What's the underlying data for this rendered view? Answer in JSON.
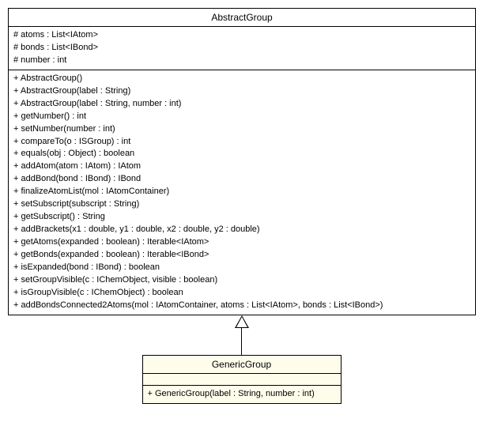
{
  "abstractClass": {
    "name": "AbstractGroup",
    "attributes": [
      "# atoms : List<IAtom>",
      "# bonds : List<IBond>",
      "# number : int"
    ],
    "methods": [
      "+ AbstractGroup()",
      "+ AbstractGroup(label : String)",
      "+ AbstractGroup(label : String, number : int)",
      "+ getNumber() : int",
      "+ setNumber(number : int)",
      "+ compareTo(o : ISGroup) : int",
      "+ equals(obj : Object) : boolean",
      "+ addAtom(atom : IAtom) : IAtom",
      "+ addBond(bond : IBond) : IBond",
      "+ finalizeAtomList(mol : IAtomContainer)",
      "+ setSubscript(subscript : String)",
      "+ getSubscript() : String",
      "+ addBrackets(x1 : double, y1 : double, x2 : double, y2 : double)",
      "+ getAtoms(expanded : boolean) : Iterable<IAtom>",
      "+ getBonds(expanded : boolean) : Iterable<IBond>",
      "+ isExpanded(bond : IBond) : boolean",
      "+ setGroupVisible(c : IChemObject, visible : boolean)",
      "+ isGroupVisible(c : IChemObject) : boolean",
      "+ addBondsConnected2Atoms(mol : IAtomContainer, atoms : List<IAtom>, bonds : List<IBond>)"
    ]
  },
  "concreteClass": {
    "name": "GenericGroup",
    "attributes": [],
    "methods": [
      "+ GenericGroup(label : String, number : int)"
    ]
  }
}
